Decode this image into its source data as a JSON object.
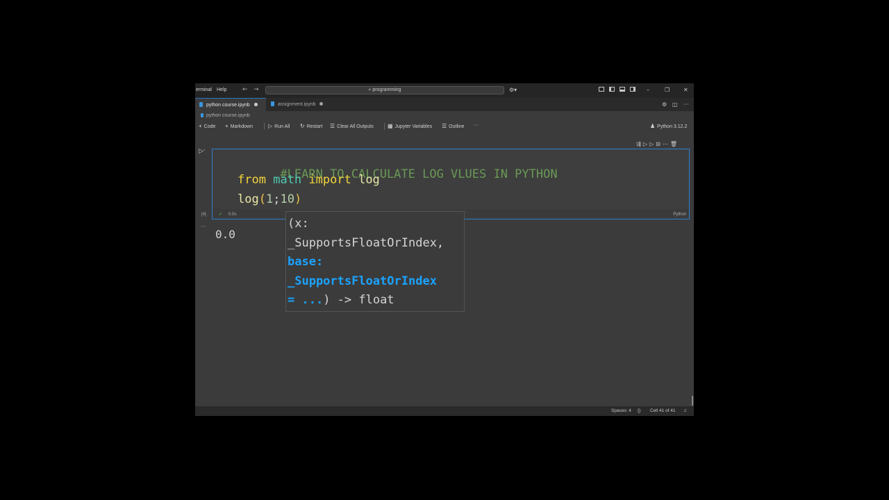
{
  "menu": {
    "terminal": "erminal",
    "help": "Help"
  },
  "nav": {
    "back": "←",
    "forward": "→"
  },
  "search": {
    "icon": "⌕",
    "text": "programming"
  },
  "tabs": [
    {
      "label": "python course.ipynb",
      "active": true
    },
    {
      "label": "assignment.ipynb",
      "active": false
    }
  ],
  "breadcrumb": "python course.ipynb",
  "toolbar": {
    "code": "Code",
    "markdown": "Markdown",
    "run_all": "Run All",
    "restart": "Restart",
    "clear_outputs": "Clear All Outputs",
    "variables": "Jupyter Variables",
    "outline": "Outline",
    "more": "···",
    "kernel": "Python 3.12.2"
  },
  "cell": {
    "comment": "#LEARN TO CALCULATE LOG VLUES IN PYTHON",
    "line2": {
      "kw_from": "from",
      "module": "math",
      "kw_import": "import",
      "name": "log"
    },
    "line3": {
      "fn": "log",
      "open": "(",
      "arg1": "1",
      "sep": ";",
      "arg2": "10",
      "close": ")"
    },
    "exec_count": "[4]",
    "status_check": "✓",
    "exec_time": "0.0s",
    "language": "Python"
  },
  "output": {
    "value": "0.0"
  },
  "signature_popup": {
    "line1": "(x:",
    "line2": "_SupportsFloatOrIndex,",
    "line3": "base:",
    "line4": "_SupportsFloatOrIndex",
    "line5_hl": "= ...",
    "line5_rest": ") -> float"
  },
  "statusbar": {
    "spaces": "Spaces: 4",
    "braces": "{}",
    "cell": "Cell 41 of 41"
  },
  "colors": {
    "accent": "#2f7fd0",
    "comment": "#6a9955",
    "keyword": "#f2d53c",
    "module": "#4ec9b0",
    "param_hl": "#1aa3ff"
  }
}
